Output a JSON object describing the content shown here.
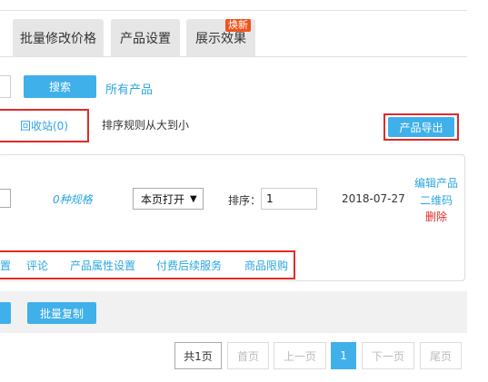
{
  "tabs": [
    {
      "label": "批量修改价格"
    },
    {
      "label": "产品设置"
    },
    {
      "label": "展示效果",
      "badge": "焕新"
    }
  ],
  "search": {
    "button": "搜索",
    "all_products": "所有产品"
  },
  "toolbar": {
    "recycle": "回收站(0)",
    "sort_rule": "排序规则从大到小",
    "export": "产品导出"
  },
  "product_row": {
    "specs": "0种规格",
    "open_mode": "本页打开",
    "sort_label": "排序：",
    "sort_value": "1",
    "date": "2018-07-27",
    "actions": {
      "edit": "编辑产品",
      "qrcode": "二维码",
      "delete": "删除"
    }
  },
  "sub_links": [
    "设置",
    "评论",
    "产品属性设置",
    "付费后续服务",
    "商品限购"
  ],
  "bottom": {
    "batch_copy": "批量复制"
  },
  "pagination": {
    "total": "共1页",
    "first": "首页",
    "prev": "上一页",
    "current": "1",
    "next": "下一页",
    "last": "尾页"
  },
  "colors": {
    "accent": "#3fb0e9",
    "link": "#2aa6e0",
    "danger": "#e02b2b",
    "badge": "#f0541e"
  }
}
